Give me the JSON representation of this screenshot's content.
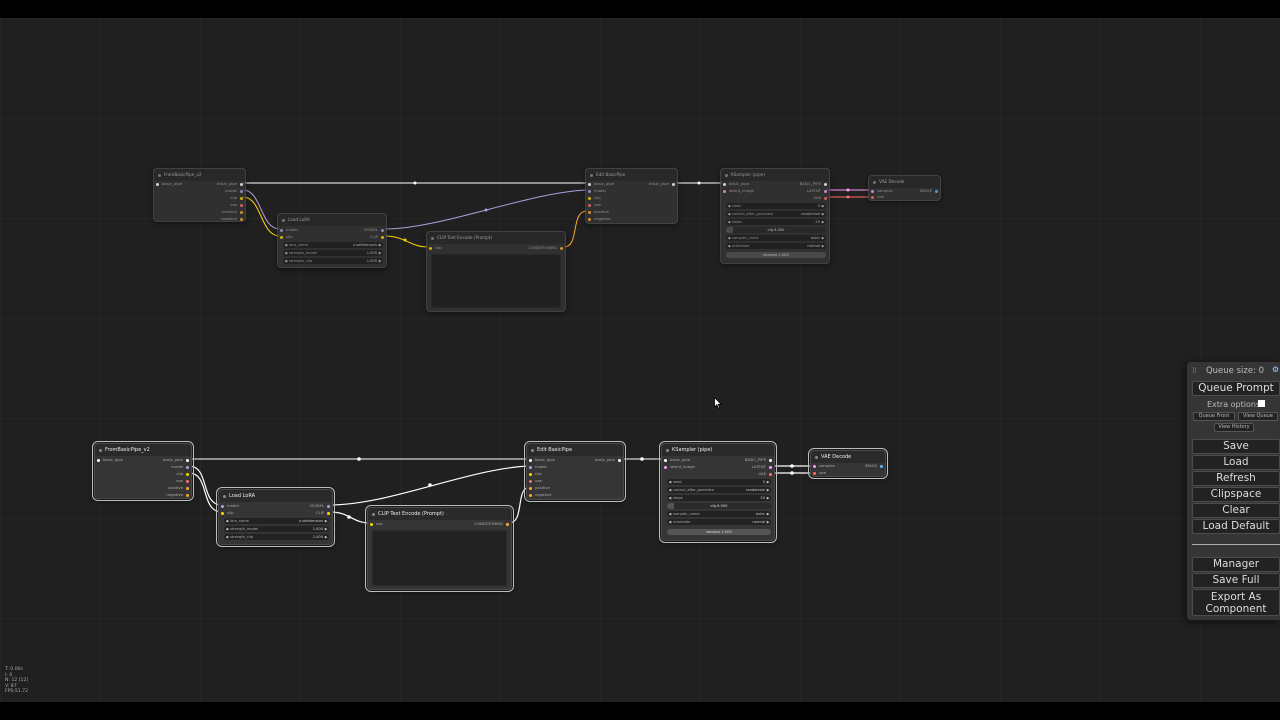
{
  "colors": {
    "canvas_bg": "#202020",
    "node_bg": "#353535",
    "pipe_socket": "#ffffff",
    "clip_socket": "#ffd500",
    "model_socket": "#b39ddb",
    "latent_socket": "#ff9cf9",
    "vae_socket": "#ff6e6e",
    "conditioning_socket": "#ffa931",
    "image_socket": "#64b5f6"
  },
  "workflow_top": {
    "from_pipe": {
      "title": "FromBasicPipe_v2",
      "input": "basic_pipe",
      "outputs": [
        "basic_pipe",
        "model",
        "clip",
        "vae",
        "positive",
        "negative"
      ]
    },
    "load_lora": {
      "title": "Load LoRA",
      "inputs": [
        "model",
        "clip"
      ],
      "outputs": [
        "MODEL",
        "CLIP"
      ],
      "widgets": [
        {
          "label": "lora_name",
          "value": "x.safetensors"
        },
        {
          "label": "strength_model",
          "value": "1.000"
        },
        {
          "label": "strength_clip",
          "value": "1.000"
        }
      ]
    },
    "clip_text": {
      "title": "CLIP Text Encode (Prompt)",
      "input": "clip",
      "output": "CONDITIONING"
    },
    "edit_pipe": {
      "title": "Edit BasicPipe",
      "inputs": [
        "basic_pipe",
        "model",
        "clip",
        "vae",
        "positive",
        "negative"
      ],
      "output": "basic_pipe"
    },
    "ksampler": {
      "title": "KSampler (pipe)",
      "inputs": [
        "basic_pipe",
        "latent_image"
      ],
      "outputs": [
        "BASIC_PIPE",
        "LATENT",
        "VAE"
      ],
      "widgets": [
        {
          "label": "seed",
          "value": "0"
        },
        {
          "label": "control_after_generate",
          "value": "randomize"
        },
        {
          "label": "steps",
          "value": "20"
        }
      ],
      "cfg": "cfg  8.000",
      "cfg_fraction": 0.0,
      "widgets2": [
        {
          "label": "sampler_name",
          "value": "euler"
        },
        {
          "label": "scheduler",
          "value": "normal"
        }
      ],
      "denoise": "denoise  1.000"
    },
    "vae_decode": {
      "title": "VAE Decode",
      "inputs": [
        "samples",
        "vae"
      ],
      "output": "IMAGE"
    }
  },
  "workflow_bottom": {
    "from_pipe": {
      "title": "FromBasicPipe_v2",
      "input": "basic_pipe",
      "outputs": [
        "basic_pipe",
        "model",
        "clip",
        "vae",
        "positive",
        "negative"
      ]
    },
    "load_lora": {
      "title": "Load LoRA",
      "inputs": [
        "model",
        "clip"
      ],
      "outputs": [
        "MODEL",
        "CLIP"
      ],
      "widgets": [
        {
          "label": "lora_name",
          "value": "x.safetensors"
        },
        {
          "label": "strength_model",
          "value": "1.000"
        },
        {
          "label": "strength_clip",
          "value": "1.000"
        }
      ]
    },
    "clip_text": {
      "title": "CLIP Text Encode (Prompt)",
      "input": "clip",
      "output": "CONDITIONING"
    },
    "edit_pipe": {
      "title": "Edit BasicPipe",
      "inputs": [
        "basic_pipe",
        "model",
        "clip",
        "vae",
        "positive",
        "negative"
      ],
      "output": "basic_pipe"
    },
    "ksampler": {
      "title": "KSampler (pipe)",
      "inputs": [
        "basic_pipe",
        "latent_image"
      ],
      "outputs": [
        "BASIC_PIPE",
        "LATENT",
        "VAE"
      ],
      "widgets": [
        {
          "label": "seed",
          "value": "0"
        },
        {
          "label": "control_after_generate",
          "value": "randomize"
        },
        {
          "label": "steps",
          "value": "20"
        }
      ],
      "cfg": "cfg  8.000",
      "cfg_fraction": 0.0,
      "widgets2": [
        {
          "label": "sampler_name",
          "value": "euler"
        },
        {
          "label": "scheduler",
          "value": "normal"
        }
      ],
      "denoise": "denoise  1.000"
    },
    "vae_decode": {
      "title": "VAE Decode",
      "inputs": [
        "samples",
        "vae"
      ],
      "output": "IMAGE"
    }
  },
  "menu": {
    "queue_size": "Queue size: 0",
    "queue_prompt": "Queue Prompt",
    "extra_options": "Extra options",
    "queue_front": "Queue Front",
    "view_queue": "View Queue",
    "view_history": "View History",
    "save": "Save",
    "load": "Load",
    "refresh": "Refresh",
    "clipspace": "Clipspace",
    "clear": "Clear",
    "load_default": "Load Default",
    "manager": "Manager",
    "save_full": "Save Full",
    "export_line1": "Export As",
    "export_line2": "Component"
  },
  "stats": {
    "t": "T: 0.00s",
    "i": "I: 0",
    "n": "N: 12 [12]",
    "v": "V: 87",
    "fps": "FPS:51.72"
  }
}
